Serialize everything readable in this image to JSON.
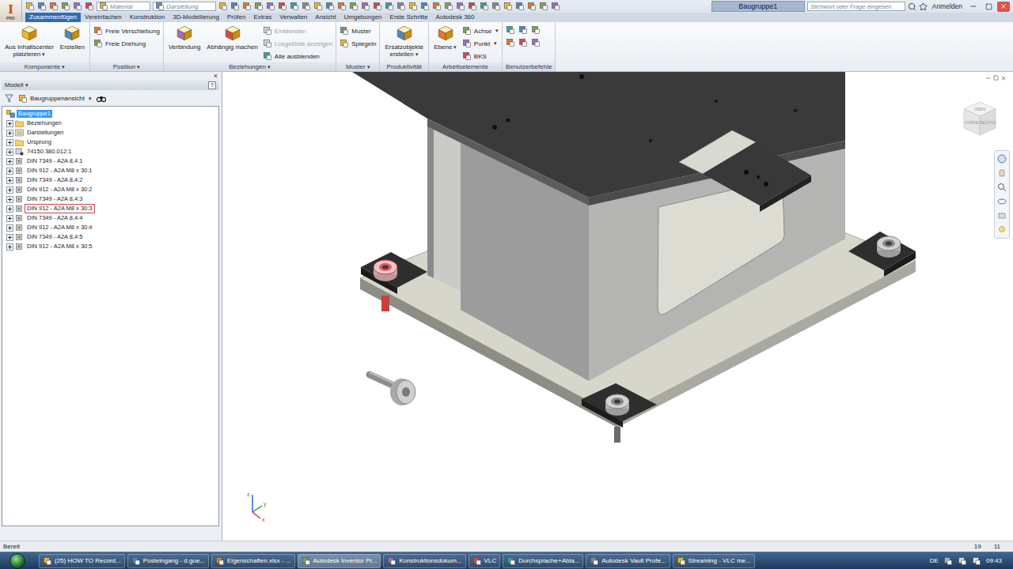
{
  "window": {
    "title": "Baugruppe1",
    "logo": {
      "letter": "I",
      "edition": "PRO"
    }
  },
  "glyphs": {
    "dropdown": "▾"
  },
  "quickAccess": {
    "material": "Material",
    "appearance": "Darstellung"
  },
  "search": {
    "placeholder": "Stichwort oder Frage eingeben"
  },
  "account": {
    "label": "Anmelden"
  },
  "menuTabs": [
    {
      "label": "Zusammenfügen",
      "selected": true
    },
    {
      "label": "Vereinfachen",
      "selected": false
    },
    {
      "label": "Konstruktion",
      "selected": false
    },
    {
      "label": "3D-Modellierung",
      "selected": false
    },
    {
      "label": "Prüfen",
      "selected": false
    },
    {
      "label": "Extras",
      "selected": false
    },
    {
      "label": "Verwalten",
      "selected": false
    },
    {
      "label": "Ansicht",
      "selected": false
    },
    {
      "label": "Umgebungen",
      "selected": false
    },
    {
      "label": "Erste Schritte",
      "selected": false
    },
    {
      "label": "Autodesk 360",
      "selected": false
    }
  ],
  "ribbon": [
    {
      "title": "Komponente",
      "dropdown": true,
      "groups": [
        {
          "kind": "large",
          "label": "Aus Inhaltscenter\nplatzieren",
          "dropdown": true,
          "disabled": false
        },
        {
          "kind": "large",
          "label": "Erstellen",
          "dropdown": false,
          "disabled": false
        }
      ]
    },
    {
      "title": "Position",
      "dropdown": true,
      "groups": [
        {
          "kind": "stack",
          "items": [
            {
              "label": "Freie Verschiebung",
              "dropdown": false,
              "disabled": false
            },
            {
              "label": "Freie Drehung",
              "dropdown": false,
              "disabled": false
            }
          ]
        }
      ]
    },
    {
      "title": "Beziehungen",
      "dropdown": true,
      "groups": [
        {
          "kind": "large",
          "label": "Verbindung",
          "dropdown": false,
          "disabled": false
        },
        {
          "kind": "large",
          "label": "Abhängig machen",
          "dropdown": false,
          "disabled": false
        },
        {
          "kind": "stack",
          "items": [
            {
              "label": "Einblenden",
              "dropdown": false,
              "disabled": true
            },
            {
              "label": "Losgelöste anzeigen",
              "dropdown": false,
              "disabled": true
            },
            {
              "label": "Alle ausblenden",
              "dropdown": false,
              "disabled": false
            }
          ]
        }
      ]
    },
    {
      "title": "Muster",
      "dropdown": true,
      "groups": [
        {
          "kind": "stack",
          "items": [
            {
              "label": "Muster",
              "dropdown": false,
              "disabled": false
            },
            {
              "label": "Spiegeln",
              "dropdown": false,
              "disabled": false
            }
          ]
        }
      ]
    },
    {
      "title": "Produktivität",
      "dropdown": false,
      "groups": [
        {
          "kind": "large",
          "label": "Ersatzobjekte\nerstellen",
          "dropdown": true,
          "disabled": false
        }
      ]
    },
    {
      "title": "Arbeitselemente",
      "dropdown": false,
      "groups": [
        {
          "kind": "large",
          "label": "Ebene",
          "dropdown": true,
          "disabled": false
        },
        {
          "kind": "stack",
          "items": [
            {
              "label": "Achse",
              "dropdown": true,
              "disabled": false
            },
            {
              "label": "Punkt",
              "dropdown": true,
              "disabled": false
            },
            {
              "label": "BKS",
              "dropdown": false,
              "disabled": false
            }
          ]
        }
      ]
    },
    {
      "title": "Benutzerbefehle",
      "dropdown": false,
      "groups": [
        {
          "kind": "icons"
        }
      ]
    }
  ],
  "browser": {
    "title": "Modell",
    "help": "?",
    "close": "×",
    "view": "Baugruppenansicht",
    "items": [
      {
        "label": "Baugruppe1",
        "kind": "assembly",
        "selected": true,
        "highlighted": false
      },
      {
        "label": "Beziehungen",
        "kind": "folder",
        "expanded": false,
        "selected": false,
        "highlighted": false
      },
      {
        "label": "Darstellungen",
        "kind": "views",
        "expanded": false,
        "selected": false,
        "highlighted": false
      },
      {
        "label": "Ursprung",
        "kind": "folder",
        "expanded": false,
        "selected": false,
        "highlighted": false
      },
      {
        "label": "74150.380.012:1",
        "kind": "grounded",
        "expanded": false,
        "selected": false,
        "highlighted": false
      },
      {
        "label": "DIN 7349 - A2A 8,4:1",
        "kind": "part",
        "expanded": false,
        "selected": false,
        "highlighted": false
      },
      {
        "label": "DIN 912 - A2A M8 x 30:1",
        "kind": "part",
        "expanded": false,
        "selected": false,
        "highlighted": false
      },
      {
        "label": "DIN 7349 - A2A 8,4:2",
        "kind": "part",
        "expanded": false,
        "selected": false,
        "highlighted": false
      },
      {
        "label": "DIN 912 - A2A M8 x 30:2",
        "kind": "part",
        "expanded": false,
        "selected": false,
        "highlighted": false
      },
      {
        "label": "DIN 7349 - A2A 8,4:3",
        "kind": "part",
        "expanded": false,
        "selected": false,
        "highlighted": false
      },
      {
        "label": "DIN 912 - A2A M8 x 30:3",
        "kind": "part",
        "expanded": false,
        "selected": false,
        "highlighted": true
      },
      {
        "label": "DIN 7349 - A2A 8,4:4",
        "kind": "part",
        "expanded": false,
        "selected": false,
        "highlighted": false
      },
      {
        "label": "DIN 912 - A2A M8 x 30:4",
        "kind": "part",
        "expanded": false,
        "selected": false,
        "highlighted": false
      },
      {
        "label": "DIN 7349 - A2A 8,4:5",
        "kind": "part",
        "expanded": false,
        "selected": false,
        "highlighted": false
      },
      {
        "label": "DIN 912 - A2A M8 x 30:5",
        "kind": "part",
        "expanded": false,
        "selected": false,
        "highlighted": false
      }
    ]
  },
  "viewcube": {
    "faces": [
      "OBEN",
      "VORNE",
      "RECHTS"
    ]
  },
  "triad": {
    "x": "x",
    "y": "y",
    "z": "z"
  },
  "statusBar": {
    "text": "Bereit",
    "values": [
      "19",
      "11"
    ]
  },
  "taskbar": {
    "items": [
      {
        "label": "(25) HOW TO Record...",
        "selected": false
      },
      {
        "label": "Posteingang - d.gue...",
        "selected": false
      },
      {
        "label": "Eigenschaften.xlsx - ...",
        "selected": false
      },
      {
        "label": "Autodesk Inventor Pr...",
        "selected": true
      },
      {
        "label": "Konstruktionsdokum...",
        "selected": false
      },
      {
        "label": "VLC",
        "selected": false
      },
      {
        "label": "Durchsprache+Abla...",
        "selected": false
      },
      {
        "label": "Autodesk Vault Profe...",
        "selected": false
      },
      {
        "label": "Streaming - VLC me...",
        "selected": false
      }
    ],
    "language": "DE",
    "clock": "09:43"
  }
}
